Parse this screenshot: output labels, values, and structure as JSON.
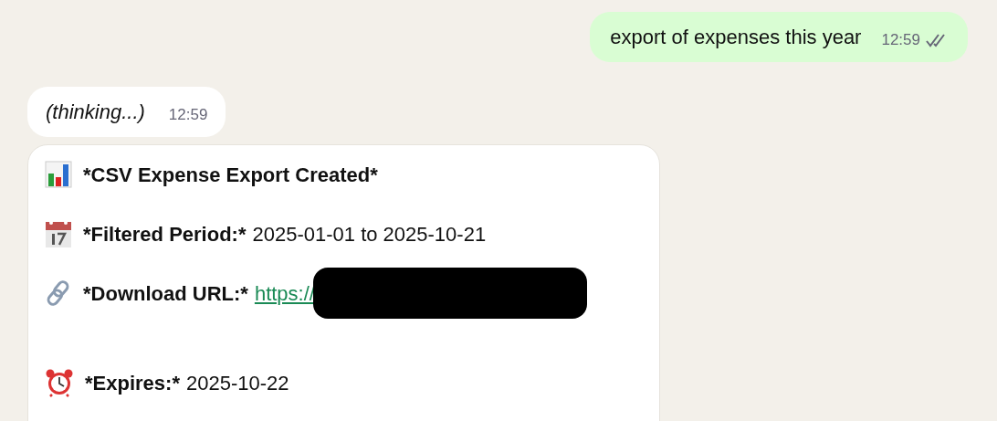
{
  "messages": [
    {
      "kind": "outgoing",
      "text": "export of expenses this year",
      "time": "12:59",
      "read": true
    },
    {
      "kind": "incoming",
      "text": "(thinking...)",
      "time": "12:59"
    }
  ],
  "card": {
    "rows": [
      {
        "kind": "title",
        "label": "*CSV Expense Export Created*"
      },
      {
        "kind": "field",
        "label": "*Filtered Period:*",
        "value": "2025-01-01 to 2025-10-21"
      },
      {
        "kind": "link",
        "label": "*Download URL:*",
        "value": "https://"
      },
      {
        "kind": "field",
        "label": "*Expires:*",
        "value": "2025-10-22"
      }
    ]
  }
}
